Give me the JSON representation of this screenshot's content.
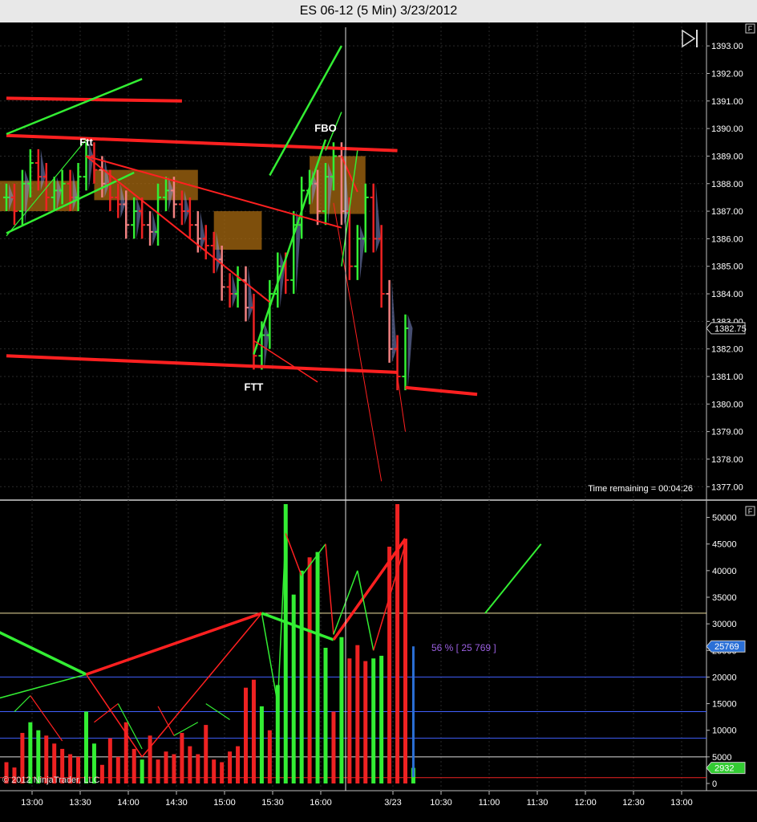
{
  "window": {
    "title": "ES 06-12 (5 Min)  3/23/2012",
    "copyright": "© 2012 NinjaTrader, LLC",
    "time_remaining": "Time remaining = 00:04:26",
    "panel_flag": "F",
    "play_icon": "skip-to-end-icon"
  },
  "colors": {
    "background": "#000000",
    "up_bar": "#33ee33",
    "down_bar": "#ee2222",
    "trendline_red": "#ff2020",
    "trendline_green": "#33ee33",
    "zone_fill": "#a86a10",
    "price_marker": "#000000",
    "volume_marker": "#2a6fd6",
    "volume_last_marker": "#33cc33",
    "info_text": "#9a5fe0"
  },
  "chart_data": [
    {
      "type": "line",
      "title": "ES 06-12 (5 Min)  3/23/2012",
      "x_tick_labels": [
        "13:00",
        "13:30",
        "14:00",
        "14:30",
        "15:00",
        "15:30",
        "16:00",
        "3/23",
        "10:30",
        "11:00",
        "11:30",
        "12:00",
        "12:30",
        "13:00"
      ],
      "y_tick_labels": [
        "1377.00",
        "1378.00",
        "1379.00",
        "1380.00",
        "1381.00",
        "1382.00",
        "1383.00",
        "1384.00",
        "1385.00",
        "1386.00",
        "1387.00",
        "1388.00",
        "1389.00",
        "1390.00",
        "1391.00",
        "1392.00",
        "1393.00"
      ],
      "ylim": [
        1376.6,
        1393.5
      ],
      "last_price": "1382.75",
      "annotations": [
        {
          "text": "FBO",
          "x": "16:10",
          "y": 1390.0
        },
        {
          "text": "Ftt",
          "x": "13:40",
          "y": 1389.5
        },
        {
          "text": "FTT",
          "x": "15:25",
          "y": 1380.6
        }
      ],
      "series": [
        {
          "x": [
            "12:50",
            "12:55",
            "13:00",
            "13:05",
            "13:10",
            "13:15",
            "13:20",
            "13:25",
            "13:30",
            "13:35",
            "13:40",
            "13:45",
            "13:50",
            "13:55",
            "14:00",
            "14:05",
            "14:10",
            "14:15",
            "14:20",
            "14:25",
            "14:30",
            "14:35",
            "14:40",
            "14:45",
            "14:50",
            "14:55",
            "15:00",
            "15:05",
            "15:10",
            "15:15",
            "15:20",
            "15:25",
            "15:30",
            "15:35",
            "15:40",
            "15:45",
            "15:50",
            "15:55",
            "16:00",
            "16:05",
            "16:10",
            "16:15",
            "3/23 09:35",
            "09:40",
            "09:45",
            "09:50",
            "09:55",
            "10:00",
            "10:05",
            "10:10",
            "10:15"
          ],
          "close": [
            1387.5,
            1387.0,
            1388.0,
            1388.75,
            1388.25,
            1387.5,
            1387.75,
            1388.0,
            1387.5,
            1388.25,
            1389.0,
            1388.5,
            1388.0,
            1387.5,
            1387.25,
            1386.5,
            1387.0,
            1386.5,
            1386.25,
            1387.5,
            1387.75,
            1387.25,
            1387.0,
            1386.5,
            1386.0,
            1385.75,
            1385.25,
            1384.25,
            1384.0,
            1384.5,
            1383.5,
            1381.75,
            1382.5,
            1384.0,
            1385.0,
            1384.5,
            1386.5,
            1387.75,
            1388.0,
            1387.0,
            1388.25,
            1389.0,
            1387.0,
            1385.0,
            1386.0,
            1387.5,
            1386.0,
            1384.0,
            1382.0,
            1381.0,
            1382.75
          ]
        }
      ],
      "trendlines": [
        {
          "color": "red",
          "from": [
            "12:50",
            1389.75
          ],
          "to": [
            "16:55",
            1389.2
          ]
        },
        {
          "color": "red",
          "from": [
            "12:50",
            1391.1
          ],
          "to": [
            "14:40",
            1391.0
          ]
        },
        {
          "color": "red",
          "from": [
            "12:50",
            1381.75
          ],
          "to": [
            "10:10",
            1381.15
          ]
        },
        {
          "color": "red",
          "from": [
            "10:15",
            1380.6
          ],
          "to": [
            "11:00",
            1380.35
          ]
        },
        {
          "color": "green",
          "from": [
            "12:50",
            1386.2
          ],
          "to": [
            "14:10",
            1388.4
          ]
        },
        {
          "color": "green",
          "from": [
            "12:50",
            1389.8
          ],
          "to": [
            "14:15",
            1391.8
          ]
        },
        {
          "color": "green",
          "from": [
            "15:25",
            1381.8
          ],
          "to": [
            "16:10",
            1389.6
          ]
        }
      ]
    },
    {
      "type": "bar",
      "title": "",
      "x_tick_labels": [
        "13:00",
        "13:30",
        "14:00",
        "14:30",
        "15:00",
        "15:30",
        "16:00",
        "3/23",
        "10:30",
        "11:00",
        "11:30",
        "12:00",
        "12:30",
        "13:00"
      ],
      "y_tick_labels": [
        "0",
        "5000",
        "10000",
        "15000",
        "20000",
        "25000",
        "30000",
        "35000",
        "40000",
        "45000",
        "50000"
      ],
      "ylim": [
        0,
        52500
      ],
      "info_label": "56 % [ 25 769 ]",
      "markers": [
        "25769",
        "2932"
      ],
      "reference_lines": [
        {
          "value": 1100,
          "color": "#ee2222"
        },
        {
          "value": 5000,
          "color": "#dddddd"
        },
        {
          "value": 8500,
          "color": "#4060ff"
        },
        {
          "value": 13500,
          "color": "#4060ff"
        },
        {
          "value": 20000,
          "color": "#4060ff"
        },
        {
          "value": 32000,
          "color": "#f0e0a0"
        }
      ],
      "bars": [
        {
          "x": "12:50",
          "value": 4000,
          "dir": "down"
        },
        {
          "x": "12:55",
          "value": 3000,
          "dir": "down"
        },
        {
          "x": "13:00",
          "value": 9500,
          "dir": "down"
        },
        {
          "x": "13:05",
          "value": 11500,
          "dir": "up"
        },
        {
          "x": "13:10",
          "value": 10000,
          "dir": "up"
        },
        {
          "x": "13:15",
          "value": 9000,
          "dir": "down"
        },
        {
          "x": "13:20",
          "value": 7500,
          "dir": "down"
        },
        {
          "x": "13:25",
          "value": 6500,
          "dir": "down"
        },
        {
          "x": "13:30",
          "value": 5500,
          "dir": "down"
        },
        {
          "x": "13:35",
          "value": 5000,
          "dir": "down"
        },
        {
          "x": "13:40",
          "value": 13500,
          "dir": "up"
        },
        {
          "x": "13:45",
          "value": 7500,
          "dir": "up"
        },
        {
          "x": "13:50",
          "value": 3500,
          "dir": "down"
        },
        {
          "x": "13:55",
          "value": 8500,
          "dir": "down"
        },
        {
          "x": "14:00",
          "value": 5000,
          "dir": "down"
        },
        {
          "x": "14:05",
          "value": 11500,
          "dir": "down"
        },
        {
          "x": "14:10",
          "value": 6500,
          "dir": "down"
        },
        {
          "x": "14:15",
          "value": 4500,
          "dir": "up"
        },
        {
          "x": "14:20",
          "value": 9000,
          "dir": "down"
        },
        {
          "x": "14:25",
          "value": 4500,
          "dir": "down"
        },
        {
          "x": "14:30",
          "value": 6000,
          "dir": "down"
        },
        {
          "x": "14:35",
          "value": 5500,
          "dir": "down"
        },
        {
          "x": "14:40",
          "value": 9500,
          "dir": "down"
        },
        {
          "x": "14:45",
          "value": 7000,
          "dir": "down"
        },
        {
          "x": "14:50",
          "value": 5500,
          "dir": "down"
        },
        {
          "x": "14:55",
          "value": 11000,
          "dir": "down"
        },
        {
          "x": "15:00",
          "value": 4500,
          "dir": "down"
        },
        {
          "x": "15:05",
          "value": 4000,
          "dir": "down"
        },
        {
          "x": "15:10",
          "value": 6000,
          "dir": "down"
        },
        {
          "x": "15:15",
          "value": 7000,
          "dir": "down"
        },
        {
          "x": "15:20",
          "value": 18000,
          "dir": "down"
        },
        {
          "x": "15:25",
          "value": 19500,
          "dir": "down"
        },
        {
          "x": "15:30",
          "value": 14500,
          "dir": "up"
        },
        {
          "x": "15:35",
          "value": 10000,
          "dir": "down"
        },
        {
          "x": "15:40",
          "value": 18500,
          "dir": "up"
        },
        {
          "x": "15:45",
          "value": 52500,
          "dir": "up"
        },
        {
          "x": "15:50",
          "value": 35500,
          "dir": "up"
        },
        {
          "x": "15:55",
          "value": 40000,
          "dir": "up"
        },
        {
          "x": "16:00",
          "value": 42500,
          "dir": "down"
        },
        {
          "x": "16:05",
          "value": 43500,
          "dir": "up"
        },
        {
          "x": "16:10",
          "value": 25500,
          "dir": "up"
        },
        {
          "x": "16:15",
          "value": 13500,
          "dir": "down"
        },
        {
          "x": "09:35",
          "value": 27500,
          "dir": "up"
        },
        {
          "x": "09:40",
          "value": 23500,
          "dir": "down"
        },
        {
          "x": "09:45",
          "value": 26000,
          "dir": "down"
        },
        {
          "x": "09:50",
          "value": 23000,
          "dir": "down"
        },
        {
          "x": "09:55",
          "value": 23500,
          "dir": "up"
        },
        {
          "x": "10:00",
          "value": 24000,
          "dir": "up"
        },
        {
          "x": "10:05",
          "value": 44500,
          "dir": "down"
        },
        {
          "x": "10:10",
          "value": 52500,
          "dir": "down"
        },
        {
          "x": "10:15",
          "value": 46000,
          "dir": "down"
        },
        {
          "x": "10:20",
          "value": 2932,
          "dir": "up"
        }
      ]
    }
  ]
}
